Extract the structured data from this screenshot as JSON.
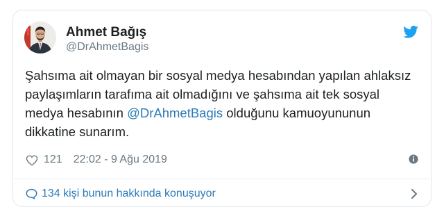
{
  "tweet": {
    "author_name": "Ahmet Bağış",
    "author_handle": "@DrAhmetBagis",
    "text_before": "Şahsıma ait olmayan bir sosyal medya hesabından yapılan ahlaksız paylaşımların tarafıma ait olmadığını ve şahsıma ait tek sosyal medya hesabının ",
    "mention": "@DrAhmetBagis",
    "text_after": " olduğunu kamuoyununun dikkatine sunarım.",
    "likes": "121",
    "timestamp": "22:02 - 9 Ağu 2019",
    "conversation_label": "134 kişi bunun hakkında konuşuyor"
  },
  "icons": {
    "bird": "twitter-bird-icon",
    "heart": "heart-icon",
    "info": "info-icon",
    "bubble": "speech-bubble-icon",
    "chevron": "chevron-right-icon"
  },
  "colors": {
    "accent": "#1da1f2",
    "link": "#2b7bb9",
    "text": "#1c2022",
    "muted": "#697882",
    "border": "#e1e8ed"
  }
}
